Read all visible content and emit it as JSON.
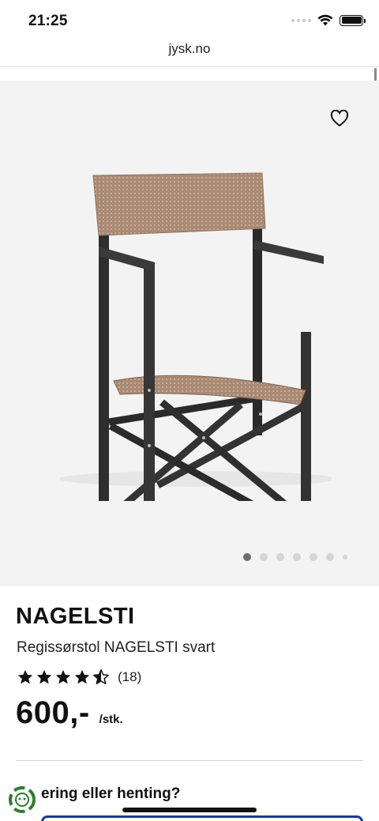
{
  "status_bar": {
    "time": "21:25"
  },
  "browser": {
    "url": "jysk.no"
  },
  "gallery": {
    "image_count": 7,
    "active_index": 0
  },
  "product": {
    "name": "NAGELSTI",
    "subtitle": "Regissørstol NAGELSTI svart",
    "rating_stars": 4.5,
    "review_count": "(18)",
    "price": "600,-",
    "price_unit": "/stk."
  },
  "delivery": {
    "question": "ering eller henting?"
  },
  "colors": {
    "accent_blue": "#143c8c",
    "chat_green": "#2e7d32",
    "gallery_bg": "#f3f3f3"
  }
}
